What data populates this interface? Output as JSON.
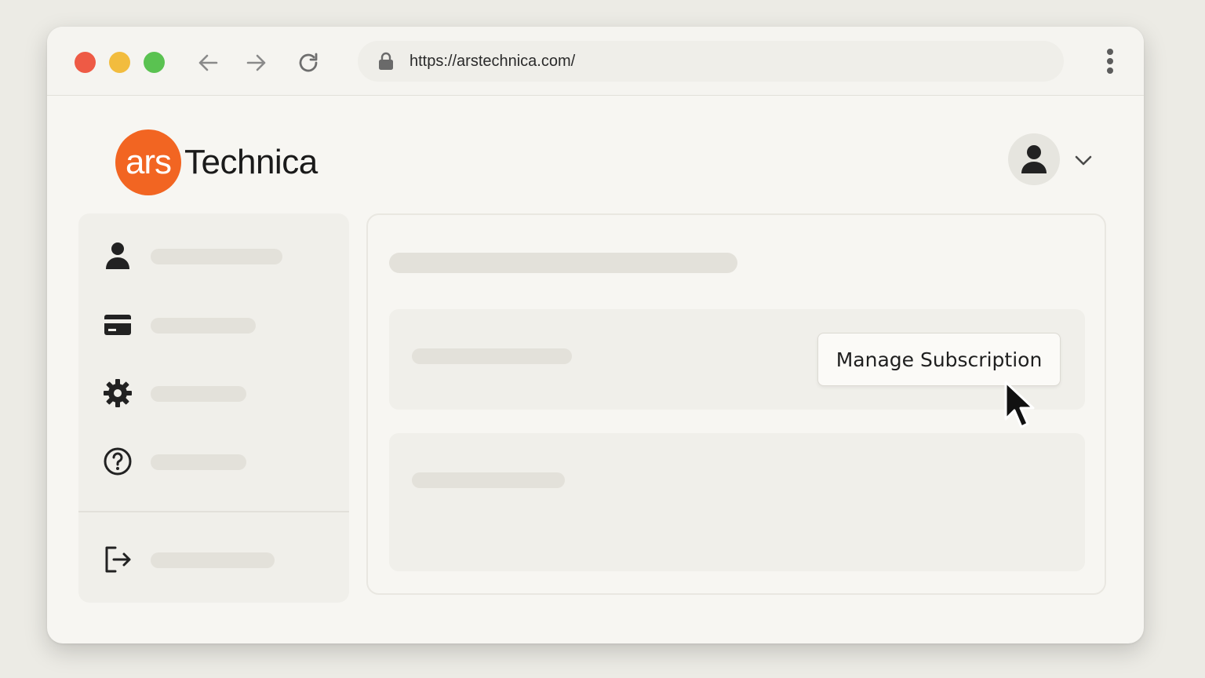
{
  "browser": {
    "url": "https://arstechnica.com/",
    "icons": {
      "back": "arrow-left-icon",
      "forward": "arrow-right-icon",
      "reload": "reload-icon",
      "lock": "lock-icon",
      "menu": "vertical-dots-icon"
    }
  },
  "site": {
    "logo_mark": "ars",
    "logo_word": "Technica",
    "brand_color": "#f26522"
  },
  "header": {
    "avatar_icon": "user-icon",
    "dropdown_icon": "chevron-down-icon"
  },
  "sidebar": {
    "items": [
      {
        "icon": "user-icon"
      },
      {
        "icon": "credit-card-icon"
      },
      {
        "icon": "gear-icon"
      },
      {
        "icon": "help-circle-icon"
      }
    ],
    "footer_item": {
      "icon": "logout-icon"
    }
  },
  "main": {
    "subscription_card": {
      "button_label": "Manage Subscription"
    }
  },
  "traffic_lights": {
    "red": "#ee5a45",
    "yellow": "#f2bc3e",
    "green": "#5ac251"
  }
}
